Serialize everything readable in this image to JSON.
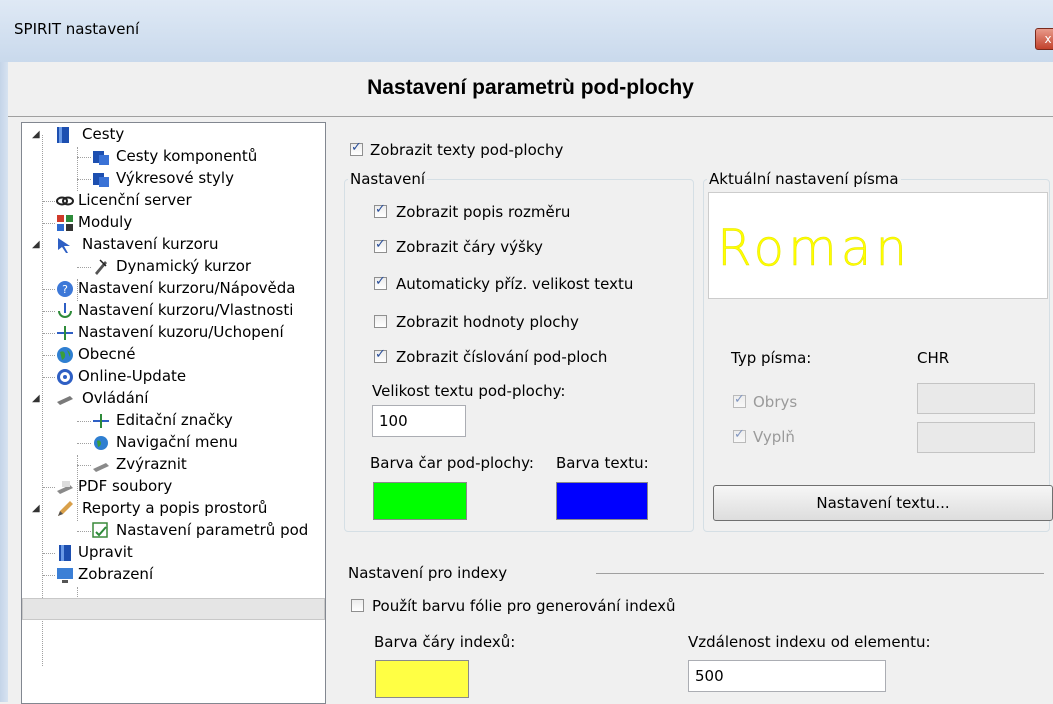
{
  "window": {
    "title": "SPIRIT nastavení",
    "close_glyph": "x"
  },
  "header": {
    "title": "Nastavení parametrù pod-plochy"
  },
  "tree": [
    {
      "label": "Cesty",
      "icon": "folder-book-icon",
      "expander": "◢"
    },
    {
      "label": "Cesty komponentů",
      "icon": "folder-blue-icon"
    },
    {
      "label": "Výkresové styly",
      "icon": "folder-blue-icon"
    },
    {
      "label": "Licenční server",
      "icon": "chain-icon"
    },
    {
      "label": "Moduly",
      "icon": "modules-icon"
    },
    {
      "label": "Nastavení kurzoru",
      "icon": "cursor-icon",
      "expander": "◢"
    },
    {
      "label": "Dynamický kurzor",
      "icon": "dynamic-cursor-icon"
    },
    {
      "label": "Nastavení kurzoru/Nápověda",
      "icon": "help-icon"
    },
    {
      "label": "Nastavení kurzoru/Vlastnosti",
      "icon": "cursor-properties-icon"
    },
    {
      "label": "Nastavení kuzoru/Uchopení",
      "icon": "crosshair-icon"
    },
    {
      "label": "Obecné",
      "icon": "globe-icon"
    },
    {
      "label": "Online-Update",
      "icon": "update-icon"
    },
    {
      "label": "Ovládání",
      "icon": "controls-icon",
      "expander": "◢"
    },
    {
      "label": "Editační značky",
      "icon": "crosshair-icon"
    },
    {
      "label": "Navigační menu",
      "icon": "globe-small-icon"
    },
    {
      "label": "Zvýraznit",
      "icon": "highlight-icon"
    },
    {
      "label": "PDF soubory",
      "icon": "pdf-icon"
    },
    {
      "label": "Reporty a popis prostorů",
      "icon": "pencil-icon",
      "expander": "◢"
    },
    {
      "label": "Nastavení parametrů pod",
      "icon": "subarea-settings-icon",
      "selected": true
    },
    {
      "label": "Upravit",
      "icon": "book-icon"
    },
    {
      "label": "Zobrazení",
      "icon": "monitor-icon"
    }
  ],
  "main": {
    "show_texts": {
      "label": "Zobrazit texty pod-plochy",
      "checked": true
    },
    "settings": {
      "title": "Nastavení",
      "options": [
        {
          "label": "Zobrazit popis rozměru",
          "checked": true
        },
        {
          "label": "Zobrazit čáry výšky",
          "checked": true
        },
        {
          "label": "Automaticky příz. velikost textu",
          "checked": true
        },
        {
          "label": "Zobrazit hodnoty plochy",
          "checked": false
        },
        {
          "label": "Zobrazit číslování pod-ploch",
          "checked": true
        }
      ],
      "text_size_label": "Velikost textu pod-plochy:",
      "text_size_value": "100",
      "line_color_label": "Barva čar pod-plochy:",
      "line_color": "#00ff00",
      "text_color_label": "Barva textu:",
      "text_color": "#0000ff"
    },
    "font": {
      "title": "Aktuální nastavení písma",
      "preview_text": "Roman",
      "preview_color": "#ffff00",
      "type_label": "Typ písma:",
      "type_value": "CHR",
      "outline_label": "Obrys",
      "outline_checked": true,
      "fill_label": "Vyplň",
      "fill_checked": true,
      "button_label": "Nastavení textu..."
    },
    "index": {
      "title": "Nastavení pro indexy",
      "use_foil_label": "Použít barvu fólie pro generování indexů",
      "use_foil_checked": false,
      "line_color_label": "Barva čáry indexů:",
      "line_color": "#ffff44",
      "distance_label": "Vzdálenost indexu od elementu:",
      "distance_value": "500"
    }
  }
}
